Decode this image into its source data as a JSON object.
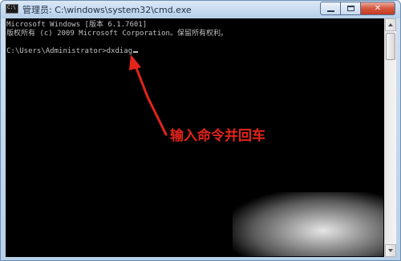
{
  "window": {
    "title": "管理员: C:\\windows\\system32\\cmd.exe",
    "icon_text": "C:\\",
    "controls": {
      "minimize": "minimize-icon",
      "maximize": "maximize-icon",
      "close": "✕"
    }
  },
  "console": {
    "lines": [
      "Microsoft Windows [版本 6.1.7601]",
      "版权所有 (c) 2009 Microsoft Corporation。保留所有权利。",
      "",
      "C:\\Users\\Administrator>dxdiag"
    ],
    "text_color": "#c0c0c0",
    "background": "#000000"
  },
  "annotation": {
    "text": "输入命令并回车",
    "color": "#e3241b"
  }
}
